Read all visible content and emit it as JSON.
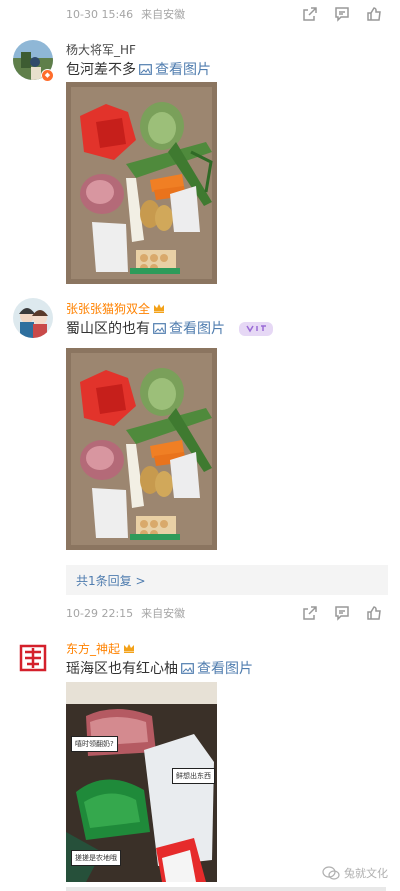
{
  "top_meta": {
    "time": "10-30 15:46",
    "source": "来自安徽"
  },
  "comments": [
    {
      "user": "杨大将军_HF",
      "text": "包河差不多",
      "view_label": "查看图片",
      "avatar": "landscape-avatar",
      "badge": "v"
    },
    {
      "user": "张张张猫狗双全",
      "text": "蜀山区的也有",
      "view_label": "查看图片",
      "avatar": "couple-avatar",
      "reply_summary": "共1条回复 >",
      "meta_time": "10-29 22:15",
      "meta_source": "来自安徽"
    },
    {
      "user": "东方_神起",
      "text": "瑶海区也有红心柚",
      "view_label": "查看图片",
      "avatar": "red-seal-avatar",
      "sticker_labels": [
        "嘻时领翻奶?",
        "鲜想出东西",
        "搓搓是农地哦"
      ]
    }
  ],
  "watermark": {
    "text": "兔就文化",
    "icon": "wechat-icon"
  },
  "colors": {
    "link": "#507daf",
    "orange_name": "#ff8200",
    "meta": "#a5a5a5"
  }
}
